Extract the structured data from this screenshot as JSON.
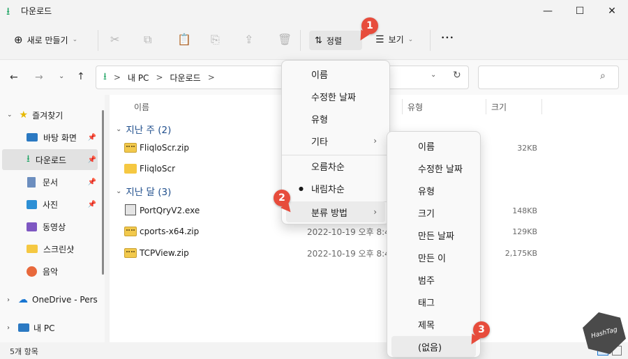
{
  "window": {
    "title": "다운로드",
    "minimize_glyph": "—",
    "maximize_glyph": "☐",
    "close_glyph": "✕"
  },
  "toolbar": {
    "new_label": "새로 만들기",
    "sort_label": "정렬",
    "view_label": "보기",
    "more_glyph": "•••"
  },
  "address": {
    "crumbs": [
      "내 PC",
      "다운로드"
    ],
    "sep": ">"
  },
  "nav": {
    "quick_access": "즐겨찾기",
    "items": [
      {
        "label": "바탕 화면",
        "icon": "desktop-icon"
      },
      {
        "label": "다운로드",
        "icon": "download-icon"
      },
      {
        "label": "문서",
        "icon": "document-icon"
      },
      {
        "label": "사진",
        "icon": "pictures-icon"
      },
      {
        "label": "동영상",
        "icon": "video-icon"
      },
      {
        "label": "스크린샷",
        "icon": "folder-icon"
      },
      {
        "label": "음악",
        "icon": "music-icon"
      }
    ],
    "onedrive": "OneDrive - Perso",
    "this_pc": "내 PC"
  },
  "columns": {
    "name": "이름",
    "type": "유형",
    "size": "크기"
  },
  "groups": [
    {
      "label": "지난 주 (2)",
      "files": [
        {
          "name": "FliqloScr.zip",
          "date": "",
          "size": "32KB",
          "icon": "zip-icon"
        },
        {
          "name": "FliqloScr",
          "date": "",
          "size": "",
          "icon": "folder-icon"
        }
      ]
    },
    {
      "label": "지난 달 (3)",
      "files": [
        {
          "name": "PortQryV2.exe",
          "date": "",
          "size": "148KB",
          "icon": "exe-icon"
        },
        {
          "name": "cports-x64.zip",
          "date": "2022-10-19 오후 8:4",
          "size": "129KB",
          "icon": "zip-icon"
        },
        {
          "name": "TCPView.zip",
          "date": "2022-10-19 오후 8:4",
          "size": "2,175KB",
          "icon": "zip-icon"
        }
      ]
    }
  ],
  "status": {
    "count": "5개 항목"
  },
  "sort_menu": {
    "items": [
      "이름",
      "수정한 날짜",
      "유형",
      "기타"
    ],
    "order": [
      "오름차순",
      "내림차순"
    ],
    "group_by": "분류 방법"
  },
  "group_menu": {
    "items": [
      "이름",
      "수정한 날짜",
      "유형",
      "크기",
      "만든 날짜",
      "만든 이",
      "범주",
      "태그",
      "제목",
      "(없음)"
    ]
  },
  "badges": [
    "1",
    "2",
    "3"
  ],
  "watermark": "HashTag",
  "colors": {
    "accent": "#1976d2",
    "badge": "#e74c3c",
    "download_green": "#1aa260",
    "group_header": "#1f4e8c"
  }
}
